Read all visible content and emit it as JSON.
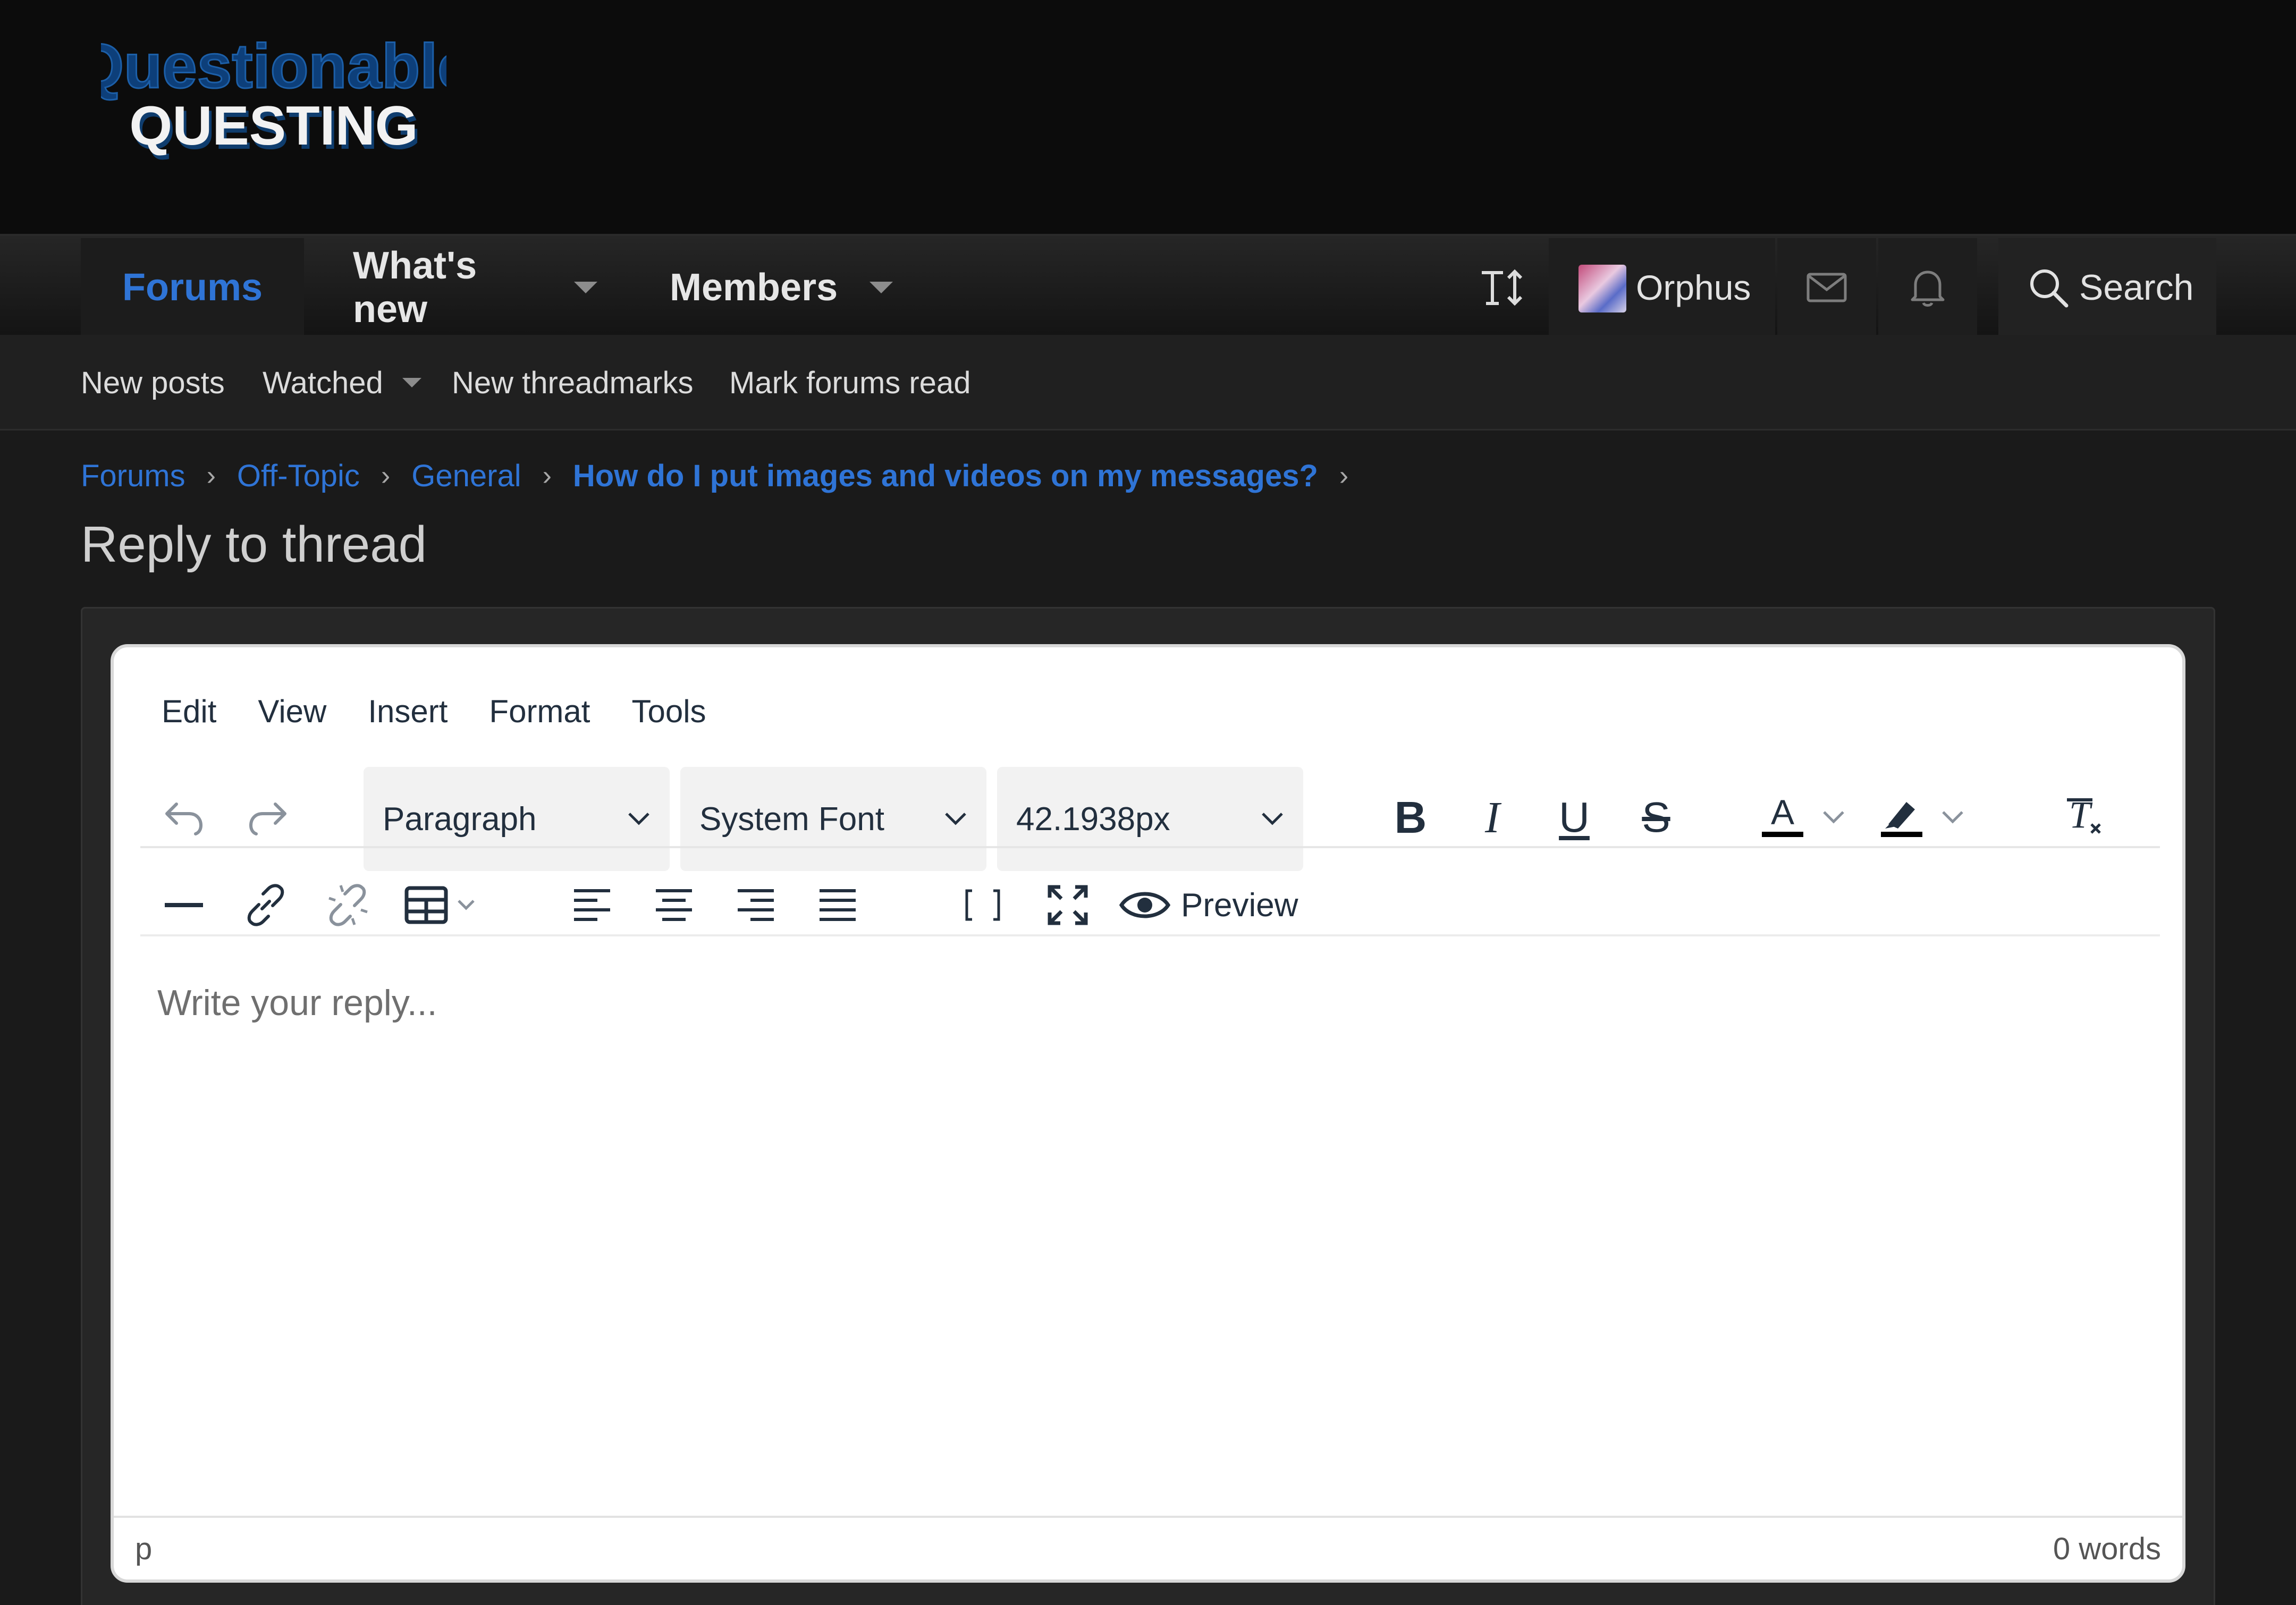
{
  "site": {
    "logo_line1": "Questionable",
    "logo_line2": "QUESTING",
    "colors": {
      "accent": "#2f74d6",
      "header_bg": "#0c0c0c",
      "body_bg": "#1a1a1a",
      "editor_bg": "#ffffff"
    }
  },
  "nav": {
    "tabs": [
      {
        "label": "Forums",
        "active": true
      },
      {
        "label": "What's new",
        "active": false
      },
      {
        "label": "Members",
        "active": false
      }
    ],
    "username": "Orphus",
    "search_label": "Search",
    "icons": [
      "text-size-icon",
      "avatar",
      "mail-icon",
      "bell-icon",
      "search-icon"
    ]
  },
  "subnav": {
    "links": [
      "New posts",
      "Watched",
      "New threadmarks",
      "Mark forums read"
    ]
  },
  "breadcrumb": [
    "Forums",
    "Off-Topic",
    "General",
    "How do I put images and videos on my messages?"
  ],
  "page_title": "Reply to thread",
  "editor": {
    "menus": [
      "Edit",
      "View",
      "Insert",
      "Format",
      "Tools"
    ],
    "block_format": "Paragraph",
    "font_family": "System Font",
    "font_size": "42.1938px",
    "preview_label": "Preview",
    "placeholder": "Write your reply...",
    "status_path": "p",
    "word_count": "0 words"
  }
}
